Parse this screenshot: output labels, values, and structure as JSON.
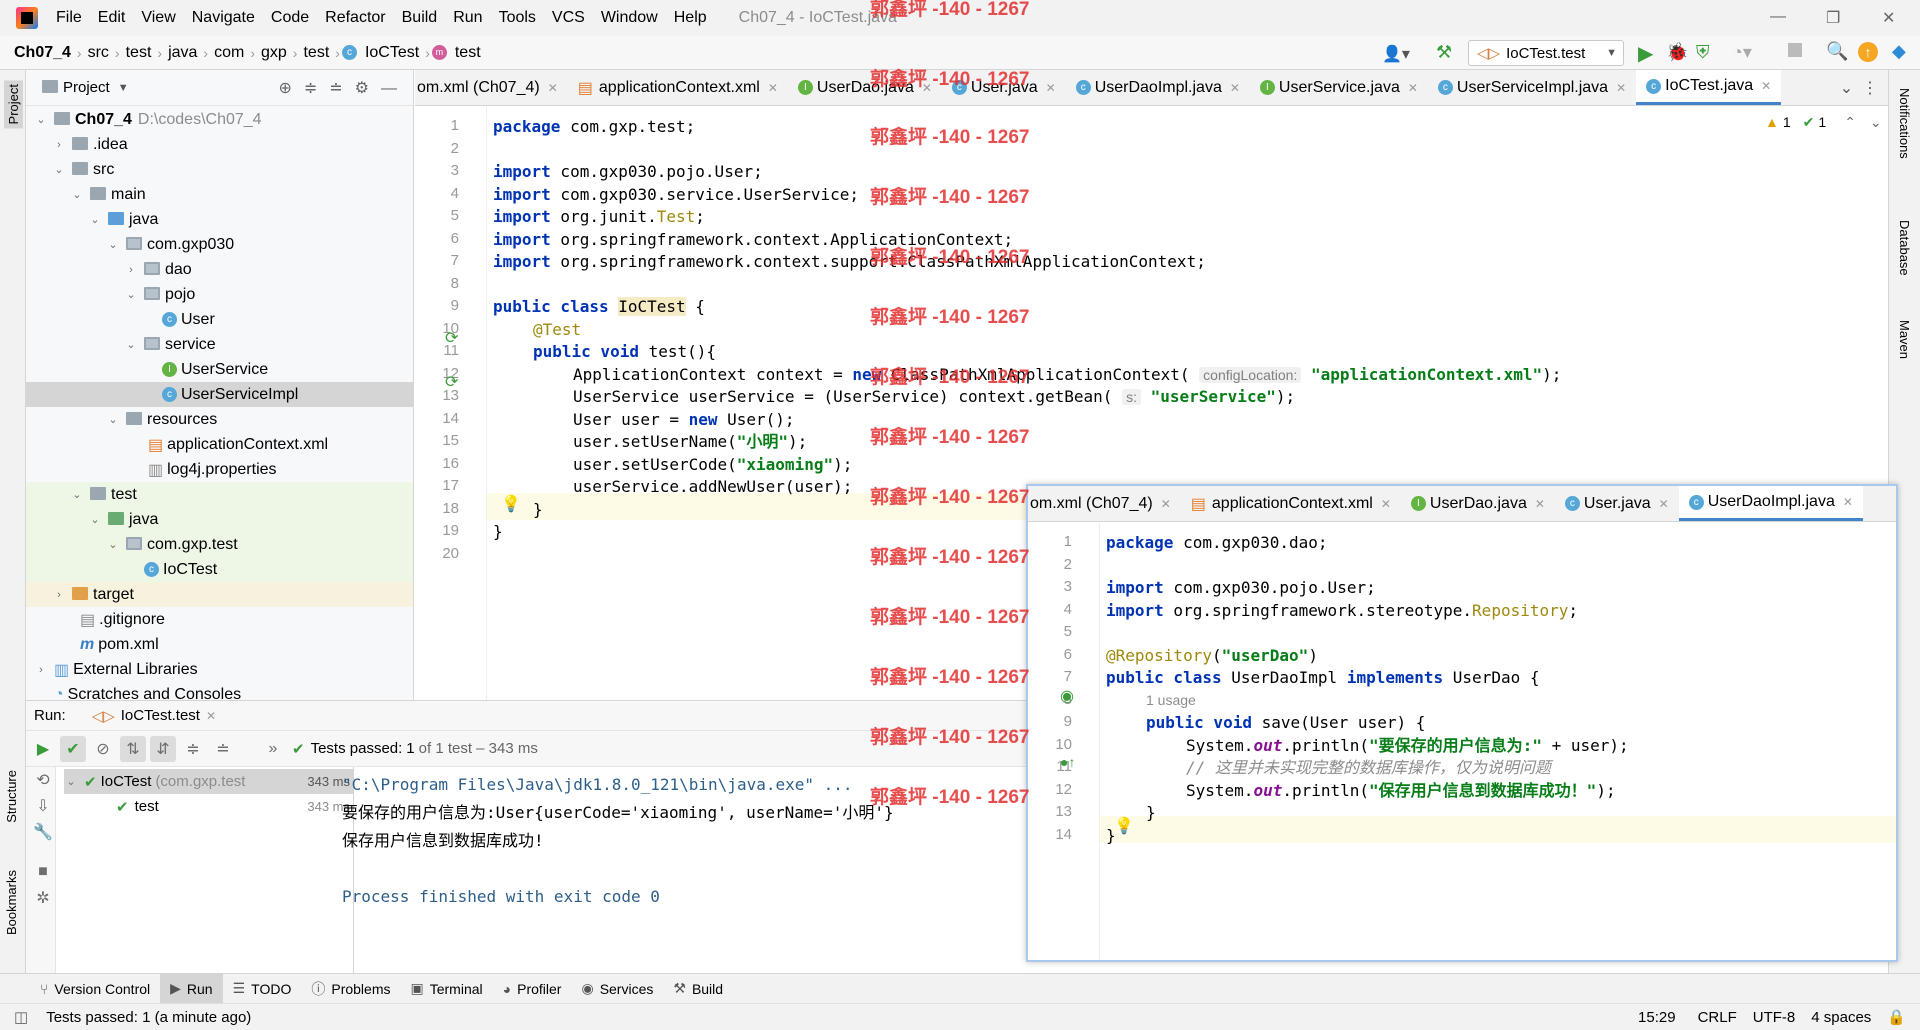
{
  "menubar": {
    "items": [
      "File",
      "Edit",
      "View",
      "Navigate",
      "Code",
      "Refactor",
      "Build",
      "Run",
      "Tools",
      "VCS",
      "Window",
      "Help"
    ],
    "window_title": "Ch07_4 - IoCTest.java"
  },
  "breadcrumb": {
    "items": [
      "Ch07_4",
      "src",
      "test",
      "java",
      "com",
      "gxp",
      "test",
      "IoCTest",
      "test"
    ],
    "run_config": "IoCTest.test"
  },
  "project": {
    "title": "Project",
    "root_name": "Ch07_4",
    "root_path": "D:\\codes\\Ch07_4",
    "nodes": [
      ".idea",
      "src",
      "main",
      "java",
      "com.gxp030",
      "dao",
      "pojo",
      "User",
      "service",
      "UserService",
      "UserServiceImpl",
      "resources",
      "applicationContext.xml",
      "log4j.properties",
      "test",
      "java",
      "com.gxp.test",
      "IoCTest",
      "target",
      ".gitignore",
      "pom.xml",
      "External Libraries",
      "Scratches and Consoles"
    ]
  },
  "editor": {
    "tabs": [
      "om.xml (Ch07_4)",
      "applicationContext.xml",
      "UserDao.java",
      "User.java",
      "UserDaoImpl.java",
      "UserService.java",
      "UserServiceImpl.java",
      "IoCTest.java"
    ],
    "inspections": {
      "warnings": "1",
      "ok": "1"
    },
    "line_numbers": [
      "1",
      "2",
      "3",
      "4",
      "5",
      "6",
      "7",
      "8",
      "9",
      "10",
      "11",
      "12",
      "13",
      "14",
      "15",
      "16",
      "17",
      "18",
      "19",
      "20"
    ],
    "hint_config": "configLocation:",
    "hint_s": "s:"
  },
  "popup": {
    "tabs": [
      "om.xml (Ch07_4)",
      "applicationContext.xml",
      "UserDao.java",
      "User.java",
      "UserDaoImpl.java"
    ],
    "line_numbers": [
      "1",
      "2",
      "3",
      "4",
      "5",
      "6",
      "7",
      "8",
      "9",
      "10",
      "11",
      "12",
      "13",
      "14"
    ],
    "usage_hint": "1 usage"
  },
  "run": {
    "label": "Run:",
    "tab": "IoCTest.test",
    "status_prefix": "Tests passed:",
    "status_count": "1",
    "status_rest": "of 1 test – 343 ms",
    "tree_root": "IoCTest",
    "tree_root_pkg": "(com.gxp.test",
    "tree_root_time": "343 ms",
    "tree_child": "test",
    "tree_child_time": "343 ms",
    "console": [
      "\"C:\\Program Files\\Java\\jdk1.8.0_121\\bin\\java.exe\" ...",
      "要保存的用户信息为:User{userCode='xiaoming', userName='小明'}",
      "保存用户信息到数据库成功!",
      "",
      "Process finished with exit code 0"
    ]
  },
  "left_strip": {
    "project": "Project",
    "structure": "Structure",
    "bookmarks": "Bookmarks"
  },
  "right_strip": {
    "notifications": "Notifications",
    "database": "Database",
    "maven": "Maven"
  },
  "bottombar": {
    "items": [
      "Version Control",
      "Run",
      "TODO",
      "Problems",
      "Terminal",
      "Profiler",
      "Services",
      "Build"
    ]
  },
  "statusbar": {
    "message": "Tests passed: 1 (a minute ago)",
    "position": "15:29",
    "line_sep": "CRLF",
    "encoding": "UTF-8",
    "indent": "4 spaces"
  },
  "watermark": "郭鑫坪 -140 - 1267",
  "colors": {
    "accent": "#4083c9",
    "keyword": "#0033b3",
    "string": "#067d17",
    "annotation": "#9e880d",
    "watermark": "#e42f2f"
  }
}
